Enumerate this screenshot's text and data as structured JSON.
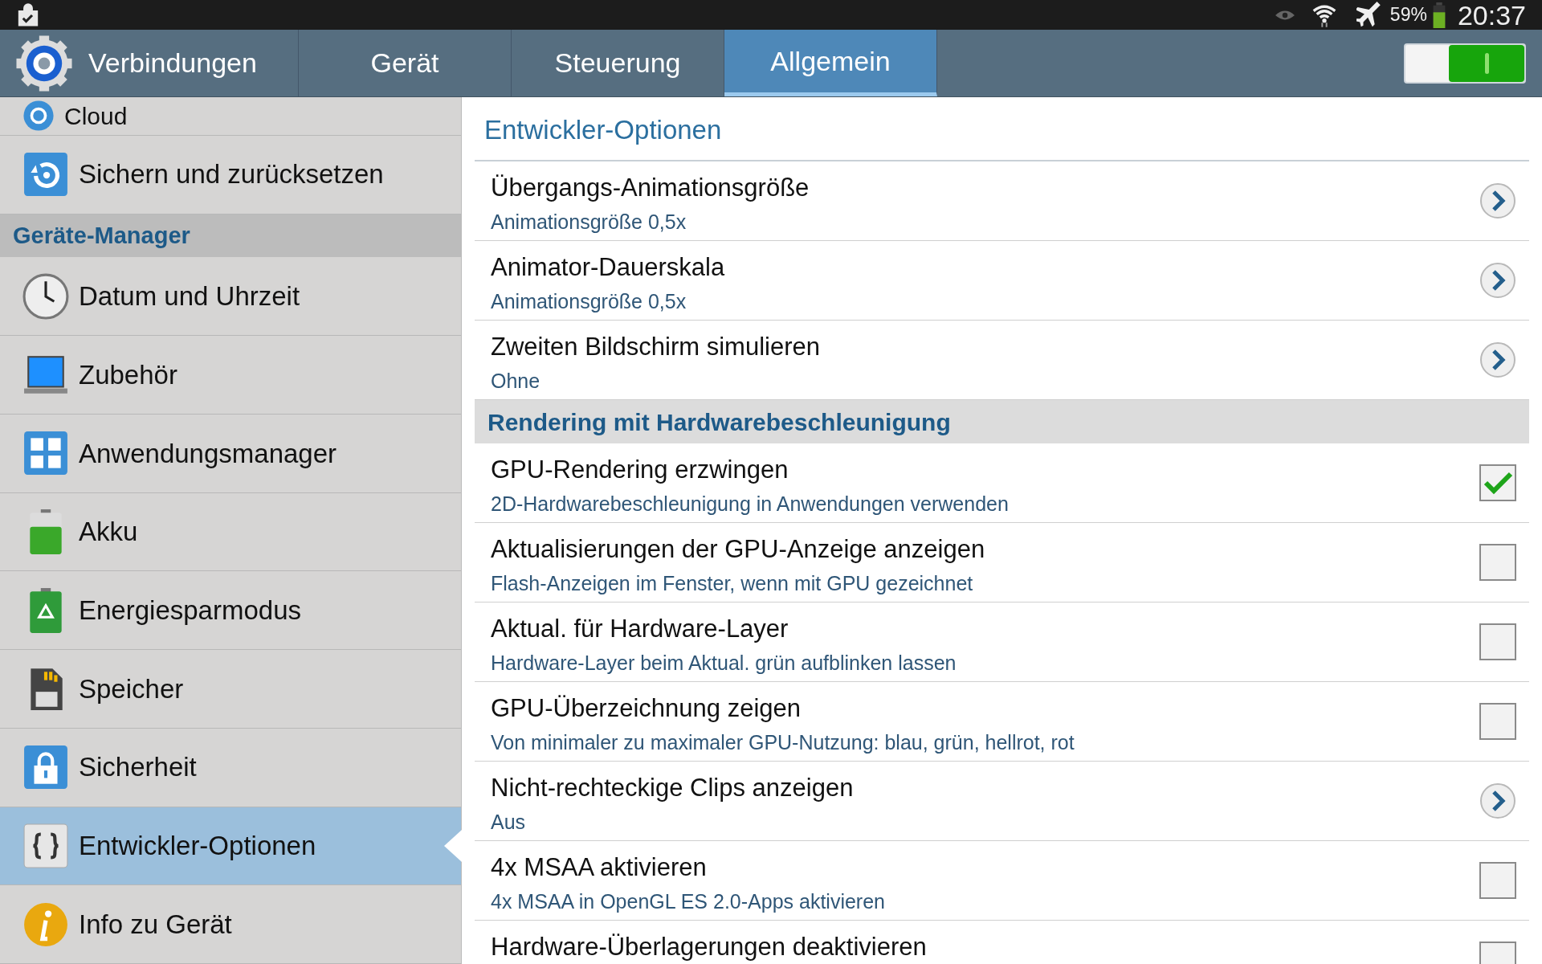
{
  "status_bar": {
    "battery_text": "59%",
    "time": "20:37"
  },
  "tabs": [
    {
      "label": "Verbindungen",
      "selected": false
    },
    {
      "label": "Gerät",
      "selected": false
    },
    {
      "label": "Steuerung",
      "selected": false
    },
    {
      "label": "Allgemein",
      "selected": true
    }
  ],
  "master_switch": {
    "on": true
  },
  "sidebar": {
    "items": [
      {
        "kind": "item",
        "label": "Cloud",
        "selected": false
      },
      {
        "kind": "item",
        "label": "Sichern und zurücksetzen",
        "selected": false
      },
      {
        "kind": "header",
        "label": "Geräte-Manager"
      },
      {
        "kind": "item",
        "label": "Datum und Uhrzeit",
        "selected": false
      },
      {
        "kind": "item",
        "label": "Zubehör",
        "selected": false
      },
      {
        "kind": "item",
        "label": "Anwendungsmanager",
        "selected": false
      },
      {
        "kind": "item",
        "label": "Akku",
        "selected": false
      },
      {
        "kind": "item",
        "label": "Energiesparmodus",
        "selected": false
      },
      {
        "kind": "item",
        "label": "Speicher",
        "selected": false
      },
      {
        "kind": "item",
        "label": "Sicherheit",
        "selected": false
      },
      {
        "kind": "item",
        "label": "Entwickler-Optionen",
        "selected": true
      },
      {
        "kind": "item",
        "label": "Info zu Gerät",
        "selected": false
      }
    ]
  },
  "panel": {
    "title": "Entwickler-Optionen",
    "items": [
      {
        "kind": "link",
        "title": "Übergangs-Animationsgröße",
        "summary": "Animationsgröße 0,5x"
      },
      {
        "kind": "link",
        "title": "Animator-Dauerskala",
        "summary": "Animationsgröße 0,5x"
      },
      {
        "kind": "link",
        "title": "Zweiten Bildschirm simulieren",
        "summary": "Ohne"
      },
      {
        "kind": "header",
        "title": "Rendering mit Hardwarebeschleunigung"
      },
      {
        "kind": "checkbox",
        "title": "GPU-Rendering erzwingen",
        "summary": "2D-Hardwarebeschleunigung in Anwendungen verwenden",
        "checked": true
      },
      {
        "kind": "checkbox",
        "title": "Aktualisierungen der GPU-Anzeige anzeigen",
        "summary": "Flash-Anzeigen im Fenster, wenn mit GPU gezeichnet",
        "checked": false
      },
      {
        "kind": "checkbox",
        "title": "Aktual. für Hardware-Layer",
        "summary": "Hardware-Layer beim Aktual. grün aufblinken lassen",
        "checked": false
      },
      {
        "kind": "checkbox",
        "title": "GPU-Überzeichnung zeigen",
        "summary": "Von minimaler zu maximaler GPU-Nutzung: blau, grün, hellrot, rot",
        "checked": false
      },
      {
        "kind": "link",
        "title": "Nicht-rechteckige Clips anzeigen",
        "summary": "Aus"
      },
      {
        "kind": "checkbox",
        "title": "4x MSAA aktivieren",
        "summary": "4x MSAA in OpenGL ES 2.0-Apps aktivieren",
        "checked": false
      },
      {
        "kind": "checkbox",
        "title": "Hardware-Überlagerungen deaktivieren",
        "checked": false
      }
    ]
  }
}
